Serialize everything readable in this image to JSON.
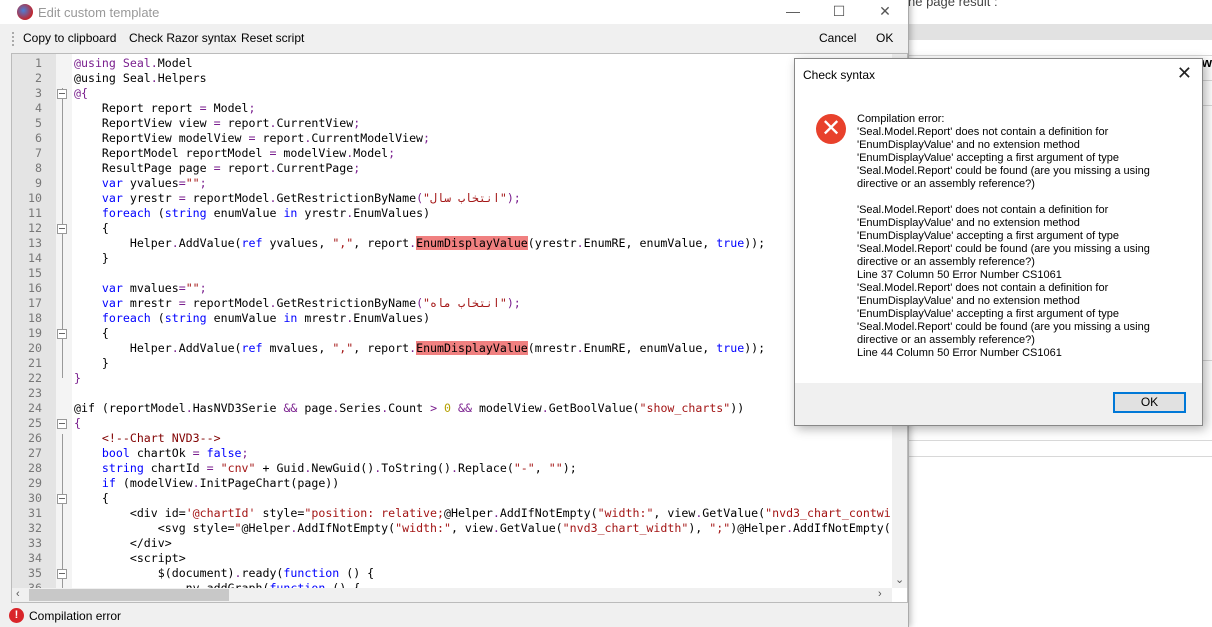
{
  "background_window": {
    "title_fragment": "he page result :",
    "header_fragment": "ew"
  },
  "window": {
    "title": "Edit custom template",
    "controls": {
      "minimize": "—",
      "maximize": "☐",
      "close": "✕"
    },
    "toolbar": {
      "copy": "Copy to clipboard",
      "check": "Check Razor syntax",
      "reset": "Reset script",
      "cancel": "Cancel",
      "ok": "OK"
    },
    "status": "Compilation error"
  },
  "editor": {
    "lines": [
      [
        [
          "@using Seal",
          "p"
        ],
        [
          ".",
          "p"
        ],
        [
          "Model",
          ""
        ]
      ],
      [
        [
          "@using Seal",
          ""
        ],
        [
          ".",
          "p"
        ],
        [
          "Helpers",
          ""
        ]
      ],
      [
        [
          "@",
          "p"
        ],
        [
          "{",
          "p"
        ]
      ],
      [
        [
          "    Report report ",
          ""
        ],
        [
          "=",
          "p"
        ],
        [
          " Model",
          ""
        ],
        [
          ";",
          "p"
        ]
      ],
      [
        [
          "    ReportView view ",
          ""
        ],
        [
          "=",
          "p"
        ],
        [
          " report",
          ""
        ],
        [
          ".",
          "p"
        ],
        [
          "CurrentView",
          ""
        ],
        [
          ";",
          "p"
        ]
      ],
      [
        [
          "    ReportView modelView ",
          ""
        ],
        [
          "=",
          "p"
        ],
        [
          " report",
          ""
        ],
        [
          ".",
          "p"
        ],
        [
          "CurrentModelView",
          ""
        ],
        [
          ";",
          "p"
        ]
      ],
      [
        [
          "    ReportModel reportModel ",
          ""
        ],
        [
          "=",
          "p"
        ],
        [
          " modelView",
          ""
        ],
        [
          ".",
          "p"
        ],
        [
          "Model",
          ""
        ],
        [
          ";",
          "p"
        ]
      ],
      [
        [
          "    ResultPage page ",
          ""
        ],
        [
          "=",
          "p"
        ],
        [
          " report",
          ""
        ],
        [
          ".",
          "p"
        ],
        [
          "CurrentPage",
          ""
        ],
        [
          ";",
          "p"
        ]
      ],
      [
        [
          "    ",
          ""
        ],
        [
          "var",
          "kw"
        ],
        [
          " yvalues",
          ""
        ],
        [
          "=",
          "p"
        ],
        [
          "\"\"",
          "str"
        ],
        [
          ";",
          "p"
        ]
      ],
      [
        [
          "    ",
          ""
        ],
        [
          "var",
          "kw"
        ],
        [
          " yrestr ",
          ""
        ],
        [
          "=",
          "p"
        ],
        [
          " reportModel",
          ""
        ],
        [
          ".",
          "p"
        ],
        [
          "GetRestrictionByName",
          ""
        ],
        [
          "(",
          "p"
        ],
        [
          "\"انتخاب سال\"",
          "str"
        ],
        [
          ");",
          "p"
        ]
      ],
      [
        [
          "    ",
          ""
        ],
        [
          "foreach",
          "kw"
        ],
        [
          " (",
          ""
        ],
        [
          "string",
          "kw"
        ],
        [
          " enumValue ",
          ""
        ],
        [
          "in",
          "kw"
        ],
        [
          " yrestr",
          ""
        ],
        [
          ".",
          "p"
        ],
        [
          "EnumValues)",
          ""
        ]
      ],
      [
        [
          "    {",
          ""
        ]
      ],
      [
        [
          "        Helper",
          ""
        ],
        [
          ".",
          "p"
        ],
        [
          "AddValue(",
          ""
        ],
        [
          "ref",
          "kw"
        ],
        [
          " yvalues, ",
          ""
        ],
        [
          "\",\"",
          "str"
        ],
        [
          ", report",
          ""
        ],
        [
          ".",
          "p"
        ],
        [
          "EnumDisplayValue",
          "hl"
        ],
        [
          "(yrestr",
          ""
        ],
        [
          ".",
          "p"
        ],
        [
          "EnumRE, enumValue, ",
          ""
        ],
        [
          "true",
          "kw"
        ],
        [
          "));",
          ""
        ]
      ],
      [
        [
          "    }",
          ""
        ]
      ],
      [
        [
          "",
          ""
        ]
      ],
      [
        [
          "    ",
          ""
        ],
        [
          "var",
          "kw"
        ],
        [
          " mvalues",
          ""
        ],
        [
          "=",
          "p"
        ],
        [
          "\"\"",
          "str"
        ],
        [
          ";",
          "p"
        ]
      ],
      [
        [
          "    ",
          ""
        ],
        [
          "var",
          "kw"
        ],
        [
          " mrestr ",
          ""
        ],
        [
          "=",
          "p"
        ],
        [
          " reportModel",
          ""
        ],
        [
          ".",
          "p"
        ],
        [
          "GetRestrictionByName",
          ""
        ],
        [
          "(",
          "p"
        ],
        [
          "\"انتخاب ماه\"",
          "str"
        ],
        [
          ");",
          "p"
        ]
      ],
      [
        [
          "    ",
          ""
        ],
        [
          "foreach",
          "kw"
        ],
        [
          " (",
          ""
        ],
        [
          "string",
          "kw"
        ],
        [
          " enumValue ",
          ""
        ],
        [
          "in",
          "kw"
        ],
        [
          " mrestr",
          ""
        ],
        [
          ".",
          "p"
        ],
        [
          "EnumValues)",
          ""
        ]
      ],
      [
        [
          "    {",
          ""
        ]
      ],
      [
        [
          "        Helper",
          ""
        ],
        [
          ".",
          "p"
        ],
        [
          "AddValue(",
          ""
        ],
        [
          "ref",
          "kw"
        ],
        [
          " mvalues, ",
          ""
        ],
        [
          "\",\"",
          "str"
        ],
        [
          ", report",
          ""
        ],
        [
          ".",
          "p"
        ],
        [
          "EnumDisplayValue",
          "hl"
        ],
        [
          "(mrestr",
          ""
        ],
        [
          ".",
          "p"
        ],
        [
          "EnumRE, enumValue, ",
          ""
        ],
        [
          "true",
          "kw"
        ],
        [
          "));",
          ""
        ]
      ],
      [
        [
          "    }",
          ""
        ]
      ],
      [
        [
          "}",
          "p"
        ]
      ],
      [
        [
          "",
          ""
        ]
      ],
      [
        [
          "@if",
          ""
        ],
        [
          " (reportModel",
          ""
        ],
        [
          ".",
          "p"
        ],
        [
          "HasNVD3Serie ",
          ""
        ],
        [
          "&&",
          "p"
        ],
        [
          " page",
          ""
        ],
        [
          ".",
          "p"
        ],
        [
          "Series",
          ""
        ],
        [
          ".",
          "p"
        ],
        [
          "Count ",
          ""
        ],
        [
          ">",
          "p"
        ],
        [
          " ",
          ""
        ],
        [
          "0",
          "num"
        ],
        [
          " ",
          ""
        ],
        [
          "&&",
          "p"
        ],
        [
          " modelView",
          ""
        ],
        [
          ".",
          "p"
        ],
        [
          "GetBoolValue(",
          ""
        ],
        [
          "\"show_charts\"",
          "str"
        ],
        [
          "))",
          ""
        ]
      ],
      [
        [
          "{",
          "p"
        ]
      ],
      [
        [
          "    ",
          ""
        ],
        [
          "<!--Chart NVD3-->",
          "tag"
        ]
      ],
      [
        [
          "    ",
          ""
        ],
        [
          "bool",
          "kw"
        ],
        [
          " chartOk ",
          ""
        ],
        [
          "=",
          "p"
        ],
        [
          " ",
          ""
        ],
        [
          "false",
          "kw"
        ],
        [
          ";",
          "p"
        ]
      ],
      [
        [
          "    ",
          ""
        ],
        [
          "string",
          "kw"
        ],
        [
          " chartId ",
          ""
        ],
        [
          "=",
          "p"
        ],
        [
          " ",
          ""
        ],
        [
          "\"cnv\"",
          "str"
        ],
        [
          " + Guid",
          ""
        ],
        [
          ".",
          "p"
        ],
        [
          "NewGuid()",
          ""
        ],
        [
          ".",
          "p"
        ],
        [
          "ToString()",
          ""
        ],
        [
          ".",
          "p"
        ],
        [
          "Replace(",
          ""
        ],
        [
          "\"-\"",
          "str"
        ],
        [
          ", ",
          ""
        ],
        [
          "\"\"",
          "str"
        ],
        [
          ");",
          ""
        ]
      ],
      [
        [
          "    ",
          ""
        ],
        [
          "if",
          "kw"
        ],
        [
          " (modelView",
          ""
        ],
        [
          ".",
          "p"
        ],
        [
          "InitPageChart(page))",
          ""
        ]
      ],
      [
        [
          "    {",
          ""
        ]
      ],
      [
        [
          "        <div id=",
          ""
        ],
        [
          "'@chartId'",
          "str"
        ],
        [
          " style=",
          ""
        ],
        [
          "\"position: relative;",
          "str"
        ],
        [
          "@Helper",
          ""
        ],
        [
          ".",
          "p"
        ],
        [
          "AddIfNotEmpty(",
          ""
        ],
        [
          "\"width:\"",
          "str"
        ],
        [
          ", view",
          ""
        ],
        [
          ".",
          "p"
        ],
        [
          "GetValue(",
          ""
        ],
        [
          "\"nvd3_chart_contwi",
          "str"
        ]
      ],
      [
        [
          "            <svg style=",
          ""
        ],
        [
          "\"",
          "str"
        ],
        [
          "@Helper",
          ""
        ],
        [
          ".",
          "p"
        ],
        [
          "AddIfNotEmpty(",
          ""
        ],
        [
          "\"width:\"",
          "str"
        ],
        [
          ", view",
          ""
        ],
        [
          ".",
          "p"
        ],
        [
          "GetValue(",
          ""
        ],
        [
          "\"nvd3_chart_width\"",
          "str"
        ],
        [
          "), ",
          ""
        ],
        [
          "\";\"",
          "str"
        ],
        [
          ")@Helper",
          ""
        ],
        [
          ".",
          "p"
        ],
        [
          "AddIfNotEmpty(",
          ""
        ]
      ],
      [
        [
          "        </div>",
          ""
        ]
      ],
      [
        [
          "        <script>",
          ""
        ]
      ],
      [
        [
          "            $(document)",
          ""
        ],
        [
          ".",
          "p"
        ],
        [
          "ready(",
          ""
        ],
        [
          "function",
          "kw"
        ],
        [
          " () {",
          ""
        ]
      ],
      [
        [
          "                nv",
          ""
        ],
        [
          ".",
          "p"
        ],
        [
          "addGraph(",
          ""
        ],
        [
          "function",
          "kw"
        ],
        [
          " () {",
          ""
        ]
      ]
    ],
    "fold_markers": [
      3,
      12,
      19,
      25,
      30,
      35
    ]
  },
  "dialog": {
    "title": "Check syntax",
    "close": "✕",
    "icon": "error-icon",
    "message": "Compilation error:\n'Seal.Model.Report' does not contain a definition for\n'EnumDisplayValue' and no extension method\n'EnumDisplayValue' accepting a first argument of type\n'Seal.Model.Report' could be found (are you missing a using\ndirective or an assembly reference?)\n\n'Seal.Model.Report' does not contain a definition for\n'EnumDisplayValue' and no extension method\n'EnumDisplayValue' accepting a first argument of type\n'Seal.Model.Report' could be found (are you missing a using\ndirective or an assembly reference?)\nLine 37 Column 50 Error Number CS1061\n'Seal.Model.Report' does not contain a definition for\n'EnumDisplayValue' and no extension method\n'EnumDisplayValue' accepting a first argument of type\n'Seal.Model.Report' could be found (are you missing a using\ndirective or an assembly reference?)\nLine 44 Column 50 Error Number CS1061",
    "ok": "OK"
  }
}
